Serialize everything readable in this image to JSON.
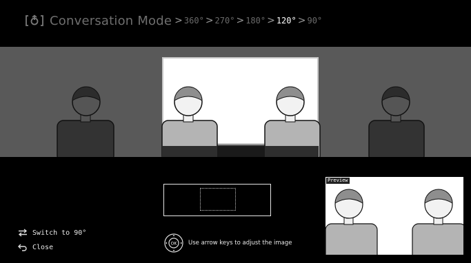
{
  "header": {
    "mode_icon": "conversation-mode-icon",
    "title": "Conversation Mode",
    "angles": [
      {
        "label": "360°",
        "active": false
      },
      {
        "label": "270°",
        "active": false
      },
      {
        "label": "180°",
        "active": false
      },
      {
        "label": "120°",
        "active": true
      },
      {
        "label": "90°",
        "active": false
      }
    ],
    "separator": ">"
  },
  "hints": {
    "switch_label": "Switch to 90°",
    "close_label": "Close",
    "arrow_keys": "Use arrow keys to adjust the image",
    "ok_label": "OK"
  },
  "preview": {
    "label": "Preview"
  },
  "colors": {
    "background": "#000000",
    "panorama": "#595959",
    "selection": "#ffffff",
    "active_angle": "#ffffff",
    "inactive_angle": "#6a6a6a"
  }
}
